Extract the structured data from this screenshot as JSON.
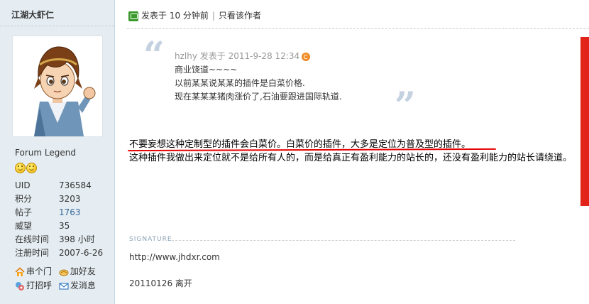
{
  "user": {
    "name": "江湖大虾仁",
    "rank": "Forum Legend",
    "stats": [
      {
        "key": "UID",
        "value": "736584",
        "link": false
      },
      {
        "key": "积分",
        "value": "3203",
        "link": false
      },
      {
        "key": "帖子",
        "value": "1763",
        "link": true
      },
      {
        "key": "威望",
        "value": "35",
        "link": false
      },
      {
        "key": "在线时间",
        "value": "398 小时",
        "link": false
      },
      {
        "key": "注册时间",
        "value": "2007-6-26",
        "link": false
      }
    ],
    "actions": [
      "串个门",
      "加好友",
      "打招呼",
      "发消息"
    ]
  },
  "post": {
    "posted_label": "发表于 10 分钟前",
    "only_author_label": "只看该作者",
    "quote": {
      "author": "hzlhy",
      "meta": "发表于 2011-9-28 12:34",
      "lines": [
        "商业饶道~~~~",
        "以前某某说某某的插件是白菜价格.",
        "现在某某某猪肉涨价了,石油要跟进国际轨道."
      ]
    },
    "body": [
      "不要妄想这种定制型的插件会白菜价。白菜价的插件，大多是定位为普及型的插件。",
      "这种插件我做出来定位就不是给所有人的，而是给真正有盈利能力的站长的，还没有盈利能力的站长请绕道。"
    ]
  },
  "signature": {
    "label": "SIGNATURE",
    "url": "http://www.jhdxr.com",
    "extra": "20110126  离开"
  },
  "colors": {
    "sidebar_bg": "#E5EDF2",
    "underline": "#E60000",
    "link": "#336699",
    "side_banner": "#E2231A"
  }
}
